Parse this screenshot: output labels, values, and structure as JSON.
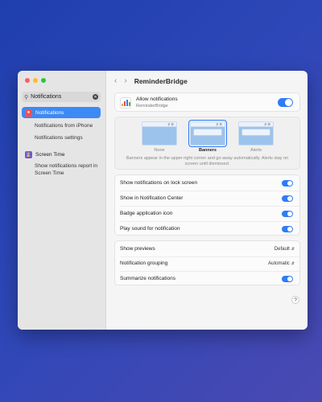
{
  "sidebar": {
    "search": {
      "value": "Notifications"
    },
    "items": [
      {
        "label": "Notifications",
        "icon": "bell-icon",
        "color": "#ff4d4d",
        "active": true
      },
      {
        "label": "Screen Time",
        "icon": "hourglass-icon",
        "color": "#6e5bd8",
        "active": false
      }
    ],
    "sub_items_notifications": [
      "Notifications from iPhone",
      "Notifications settings"
    ],
    "sub_items_screentime": [
      "Show notifications report in Screen Time"
    ]
  },
  "header": {
    "title": "ReminderBridge"
  },
  "allow": {
    "label": "Allow notifications",
    "app_name": "ReminderBridge",
    "enabled": true
  },
  "alert_styles": {
    "options": [
      "None",
      "Banners",
      "Alerts"
    ],
    "selected": "Banners",
    "description": "Banners appear in the upper-right corner and go away automatically. Alerts stay on screen until dismissed."
  },
  "toggles": [
    {
      "label": "Show notifications on lock screen",
      "enabled": true
    },
    {
      "label": "Show in Notification Center",
      "enabled": true
    },
    {
      "label": "Badge application icon",
      "enabled": true
    },
    {
      "label": "Play sound for notification",
      "enabled": true
    }
  ],
  "options": {
    "show_previews": {
      "label": "Show previews",
      "value": "Default"
    },
    "grouping": {
      "label": "Notification grouping",
      "value": "Automatic"
    },
    "summarize": {
      "label": "Summarize notifications",
      "enabled": true
    }
  },
  "help_label": "?",
  "colors": {
    "accent": "#2f7cf6",
    "sidebar_active": "#3d89f5"
  }
}
